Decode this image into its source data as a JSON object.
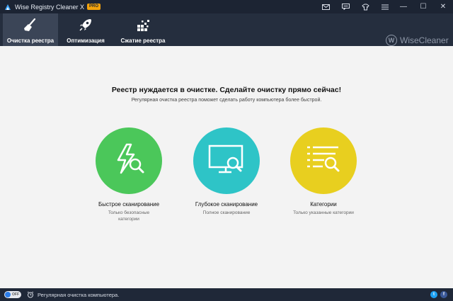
{
  "window": {
    "title": "Wise Registry Cleaner X",
    "badge": "PRO",
    "controls": [
      "—",
      "☐",
      "✕"
    ]
  },
  "titlebar_icons": [
    "mail-icon",
    "feedback-icon",
    "skin-icon",
    "menu-icon"
  ],
  "toolbar": {
    "tabs": [
      {
        "label": "Очистка реестра",
        "icon": "broom-icon",
        "active": true
      },
      {
        "label": "Оптимизация",
        "icon": "rocket-icon",
        "active": false
      },
      {
        "label": "Сжатие реестра",
        "icon": "blocks-icon",
        "active": false
      }
    ],
    "brand": "WiseCleaner",
    "brand_mark": "W"
  },
  "main": {
    "headline": "Реестр нуждается в очистке. Сделайте очистку прямо сейчас!",
    "subline": "Регулярная очистка реестра поможет сделать работу компьютера более быстрой.",
    "options": [
      {
        "title": "Быстрое сканирование",
        "desc1": "Только безопасные",
        "desc2": "категории",
        "icon": "lightning-search-icon",
        "color": "#4bc75a"
      },
      {
        "title": "Глубокое сканирование",
        "desc1": "Полное сканирование",
        "desc2": "",
        "icon": "monitor-search-icon",
        "color": "#2ec4c7"
      },
      {
        "title": "Категории",
        "desc1": "Только указанные категории",
        "desc2": "",
        "icon": "list-search-icon",
        "color": "#e8cf1f"
      }
    ]
  },
  "statusbar": {
    "toggle": "OFF",
    "text": "Регулярная очистка компьютера.",
    "social": [
      "twitter-icon",
      "facebook-icon"
    ]
  },
  "colors": {
    "titlebar": "#1c2433",
    "toolbar": "#252e3e",
    "active_tab": "#3b4557",
    "background": "#f3f3f3",
    "statusbar": "#1f2838"
  }
}
